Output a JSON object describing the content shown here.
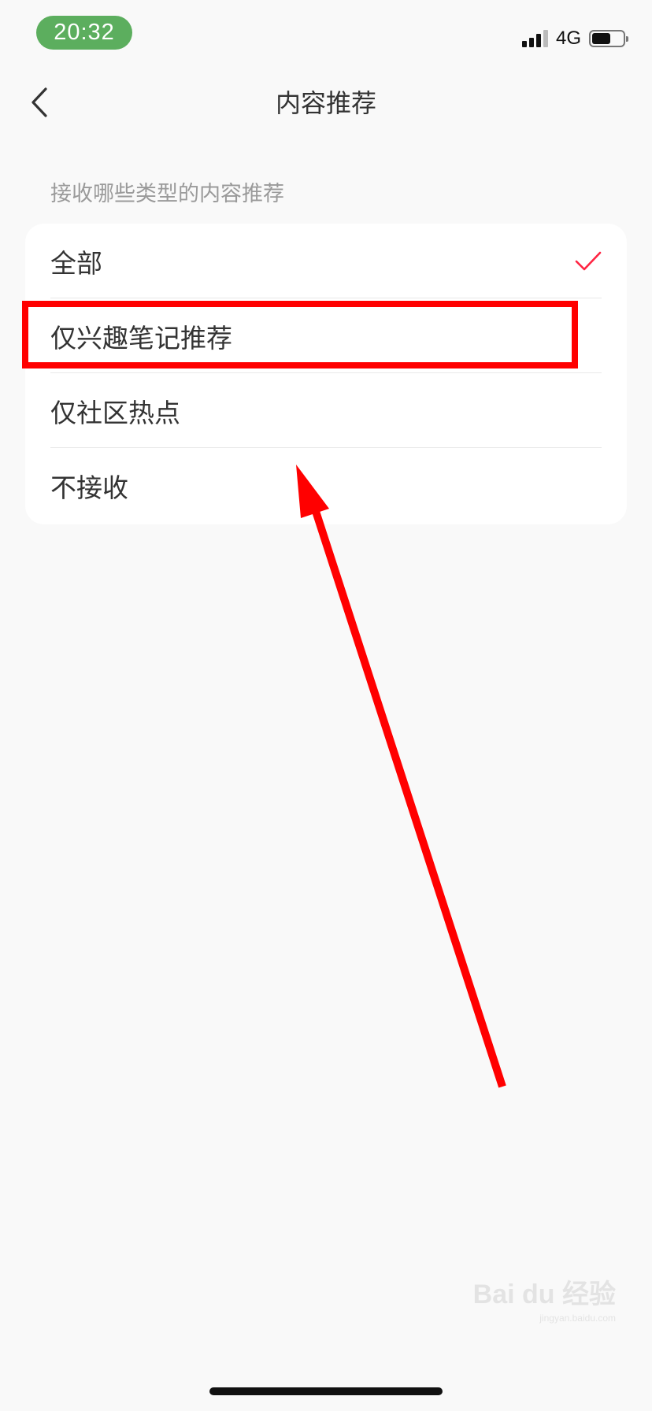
{
  "status_bar": {
    "time": "20:32",
    "network": "4G",
    "battery_level": 0.6,
    "signal_bars": 3,
    "time_badge_color": "#5cae5e"
  },
  "nav": {
    "title": "内容推荐",
    "back_icon": "chevron-left-icon"
  },
  "section": {
    "label": "接收哪些类型的内容推荐",
    "options": [
      {
        "label": "全部",
        "selected": true
      },
      {
        "label": "仅兴趣笔记推荐",
        "selected": false
      },
      {
        "label": "仅社区热点",
        "selected": false
      },
      {
        "label": "不接收",
        "selected": false
      }
    ]
  },
  "colors": {
    "accent_check": "#ff2442",
    "annotation": "#ff0000",
    "background": "#f9f9f9"
  },
  "watermark": {
    "logo": "Bai du 经验",
    "url": "jingyan.baidu.com"
  }
}
